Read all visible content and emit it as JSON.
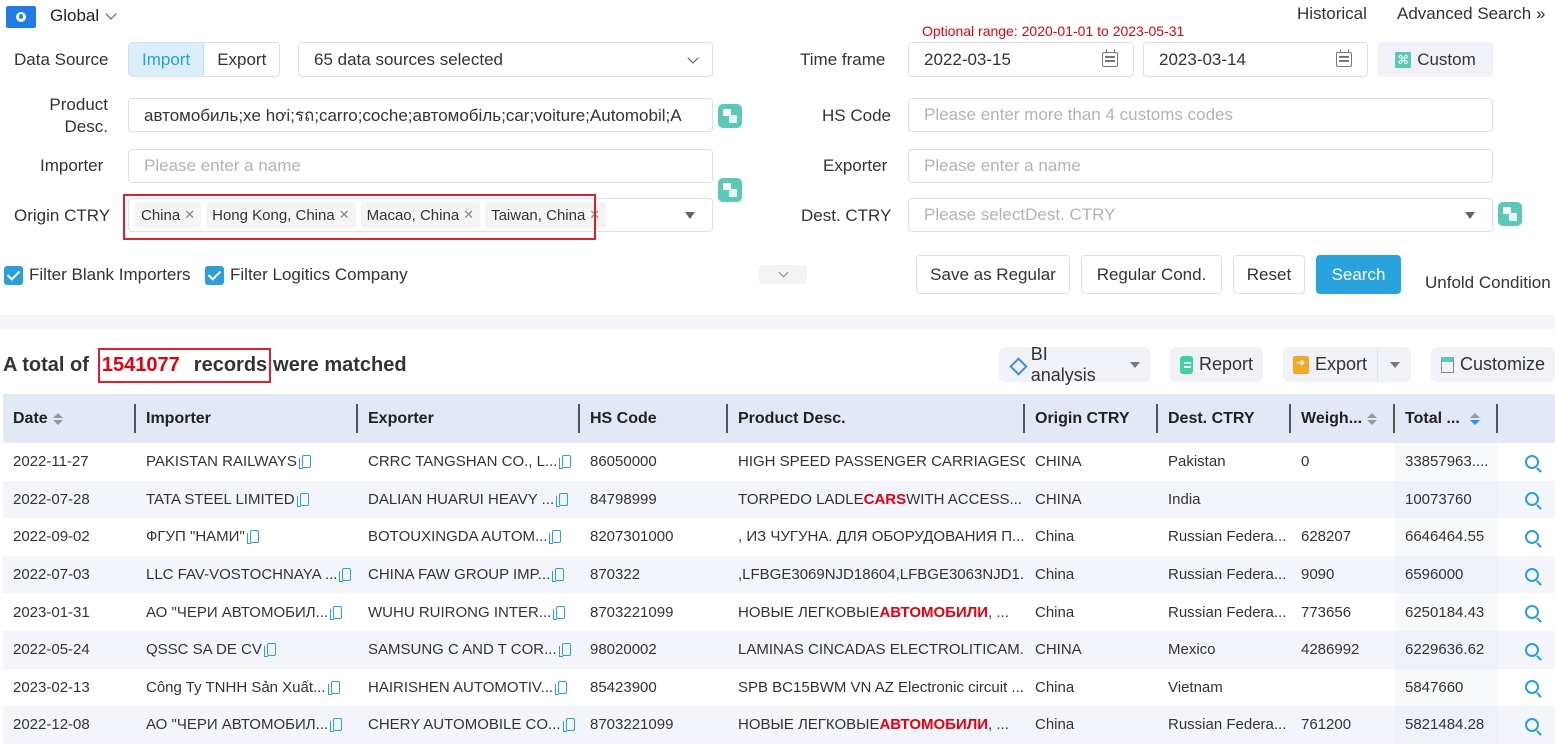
{
  "topbar": {
    "region_icon": "globe-icon",
    "region": "Global",
    "historical": "Historical",
    "advanced_search": "Advanced Search",
    "advanced_search_icon": "double-chevron-right-icon"
  },
  "filters": {
    "data_source_label": "Data Source",
    "direction_options": [
      "Import",
      "Export"
    ],
    "direction_selected": "Import",
    "sources_selected": "65 data sources selected",
    "optional_range": "Optional range:  2020-01-01 to 2023-05-31",
    "time_frame_label": "Time frame",
    "date_from": "2022-03-15",
    "date_to": "2023-03-14",
    "custom_label": "Custom",
    "product_desc_label_1": "Product",
    "product_desc_label_2": "Desc.",
    "product_desc_value": "автомобиль;xe hơi;รถ;carro;coche;автомобіль;car;voiture;Automobil;A",
    "hs_code_label": "HS Code",
    "hs_code_placeholder": "Please enter more than 4 customs codes",
    "importer_label": "Importer",
    "importer_placeholder": "Please enter a name",
    "exporter_label": "Exporter",
    "exporter_placeholder": "Please enter a name",
    "origin_label": "Origin CTRY",
    "origin_tags": [
      "China",
      "Hong Kong, China",
      "Macao, China",
      "Taiwan, China"
    ],
    "dest_label": "Dest. CTRY",
    "dest_placeholder": "Please selectDest. CTRY",
    "filter_blank_importers": "Filter Blank Importers",
    "filter_logistics": "Filter Logitics Company",
    "save_regular": "Save as Regular",
    "regular_cond": "Regular Cond.",
    "reset": "Reset",
    "search": "Search",
    "unfold": "Unfold Condition"
  },
  "results": {
    "prefix": "A total of",
    "count": "1541077",
    "records": "records",
    "suffix": "were matched",
    "bi_analysis": "BI analysis",
    "report": "Report",
    "export": "Export",
    "customize": "Customize"
  },
  "table": {
    "columns": [
      "Date",
      "Importer",
      "Exporter",
      "HS Code",
      "Product Desc.",
      "Origin CTRY",
      "Dest. CTRY",
      "Weigh...",
      "Total ..."
    ],
    "rows": [
      {
        "date": "2022-11-27",
        "importer": "PAKISTAN RAILWAYS",
        "exporter": "CRRC TANGSHAN CO., L...",
        "hs": "86050000",
        "desc_pre": "HIGH SPEED PASSENGER CARRIAGESC...",
        "desc_hl": "",
        "desc_post": "",
        "origin": "CHINA",
        "dest": "Pakistan",
        "weight": "0",
        "total": "33857963...."
      },
      {
        "date": "2022-07-28",
        "importer": "TATA STEEL LIMITED",
        "exporter": "DALIAN HUARUI HEAVY ...",
        "hs": "84798999",
        "desc_pre": "TORPEDO LADLE ",
        "desc_hl": "CARS",
        "desc_post": " WITH ACCESS...",
        "origin": "CHINA",
        "dest": "India",
        "weight": "",
        "total": "10073760"
      },
      {
        "date": "2022-09-02",
        "importer": "ФГУП \"НАМИ\"",
        "exporter": "BOTOUXINGDA AUTOM...",
        "hs": "8207301000",
        "desc_pre": ", ИЗ ЧУГУНА. ДЛЯ ОБОРУДОВАНИЯ П...",
        "desc_hl": "",
        "desc_post": "",
        "origin": "China",
        "dest": "Russian Federa...",
        "weight": "628207",
        "total": "6646464.55"
      },
      {
        "date": "2022-07-03",
        "importer": "LLC FAV-VOSTOCHNAYA ...",
        "exporter": "CHINA FAW GROUP IMP...",
        "hs": "870322",
        "desc_pre": ",LFBGE3069NJD18604,LFBGE3063NJD1...",
        "desc_hl": "",
        "desc_post": "",
        "origin": "China",
        "dest": "Russian Federa...",
        "weight": "9090",
        "total": "6596000"
      },
      {
        "date": "2023-01-31",
        "importer": "АО \"ЧЕРИ АВТОМОБИЛ...",
        "exporter": "WUHU RUIRONG INTER...",
        "hs": "8703221099",
        "desc_pre": "НОВЫЕ ЛЕГКОВЫЕ ",
        "desc_hl": "АВТОМОБИЛИ",
        "desc_post": ", ...",
        "origin": "China",
        "dest": "Russian Federa...",
        "weight": "773656",
        "total": "6250184.43"
      },
      {
        "date": "2022-05-24",
        "importer": "QSSC SA DE CV",
        "exporter": "SAMSUNG C AND T COR...",
        "hs": "98020002",
        "desc_pre": "LAMINAS CINCADAS ELECTROLITICAM...",
        "desc_hl": "",
        "desc_post": "",
        "origin": "CHINA",
        "dest": "Mexico",
        "weight": "4286992",
        "total": "6229636.62"
      },
      {
        "date": "2023-02-13",
        "importer": "Công Ty TNHH Sản Xuất...",
        "exporter": "HAIRISHEN AUTOMOTIV...",
        "hs": "85423900",
        "desc_pre": "SPB BC15BWM VN AZ Electronic circuit ...",
        "desc_hl": "",
        "desc_post": "",
        "origin": "China",
        "dest": "Vietnam",
        "weight": "",
        "total": "5847660"
      },
      {
        "date": "2022-12-08",
        "importer": "АО \"ЧЕРИ АВТОМОБИЛ...",
        "exporter": "CHERY AUTOMOBILE CO...",
        "hs": "8703221099",
        "desc_pre": "НОВЫЕ ЛЕГКОВЫЕ ",
        "desc_hl": "АВТОМОБИЛИ",
        "desc_post": ", ...",
        "origin": "China",
        "dest": "Russian Federa...",
        "weight": "761200",
        "total": "5821484.28"
      }
    ]
  },
  "colors": {
    "accent": "#29a3de",
    "highlight_red": "#e60012",
    "header_bg": "#e2e8f5",
    "teal_icon": "#5cc8b8"
  }
}
